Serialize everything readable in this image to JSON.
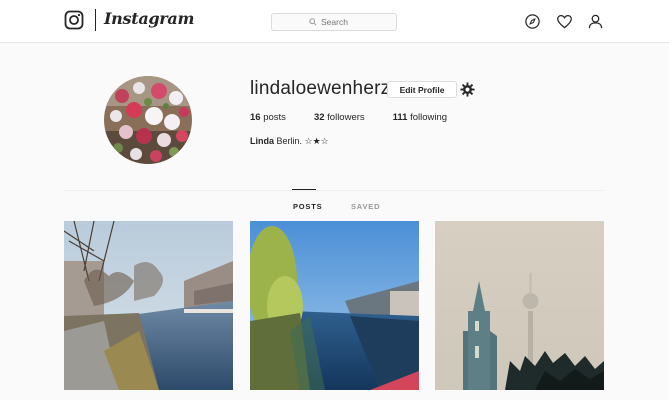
{
  "header": {
    "logo_text": "Instagram",
    "search_placeholder": "Search"
  },
  "profile": {
    "username": "lindaloewenherz",
    "edit_label": "Edit Profile",
    "stats": {
      "posts_count": "16",
      "posts_label": "posts",
      "followers_count": "32",
      "followers_label": "followers",
      "following_count": "111",
      "following_label": "following"
    },
    "bio_name": "Linda",
    "bio_text": "Berlin. ☆★☆"
  },
  "tabs": [
    {
      "label": "POSTS",
      "active": true
    },
    {
      "label": "SAVED",
      "active": false
    }
  ],
  "posts": [
    {
      "subject": "canal with bare trees"
    },
    {
      "subject": "river under blue sky"
    },
    {
      "subject": "foggy church and tv tower"
    }
  ],
  "icons": {
    "logo": "instagram-camera-icon",
    "search": "search-icon",
    "explore": "compass-icon",
    "activity": "heart-icon",
    "profile": "user-icon",
    "settings": "gear-icon"
  }
}
